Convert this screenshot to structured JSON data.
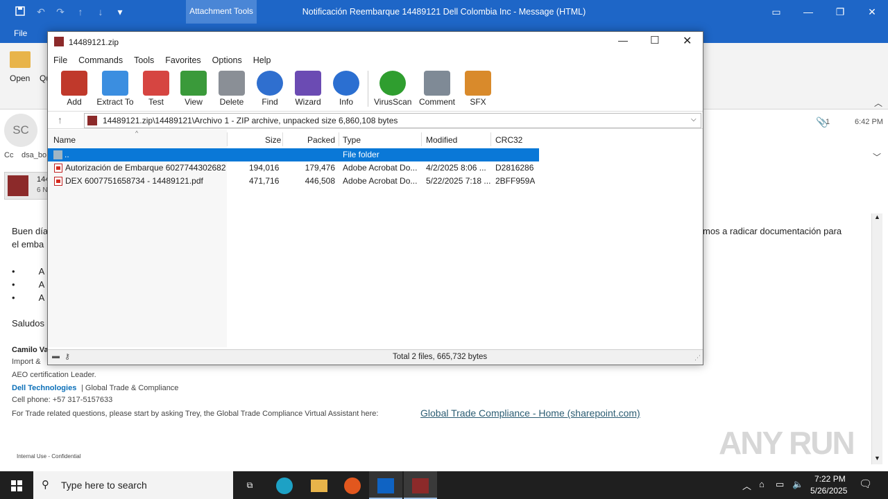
{
  "outlook": {
    "title": "Notificación Reembarque 14489121 Dell Colombia Inc  -  Message (HTML)",
    "context_tab": "Attachment Tools",
    "file_tab": "File",
    "ribbon": {
      "open_label": "Open",
      "quick_label": "Qu"
    },
    "header": {
      "avatar_initials": "SC",
      "cc_label": "Cc",
      "cc_value": "dsa_bo",
      "attachment_count": "1",
      "time": "6:42 PM",
      "attachment_name": "144",
      "attachment_size": "6 N"
    },
    "body": {
      "greeting": "Buen día",
      "greeting_tail": "mos a radicar documentación para",
      "line2": "el emba",
      "bullets": [
        "A",
        "A",
        "A"
      ],
      "closing": "Saludos",
      "signature_name": "Camilo Va",
      "signature_role": "Import &",
      "aeo": "AEO certification Leader.",
      "company": "Dell Technologies",
      "division": "| Global Trade & Compliance",
      "phone": "Cell phone: +57 317-5157633",
      "trade_text": "For Trade related questions, please start by asking Trey, the Global Trade Compliance Virtual Assistant here: ",
      "trade_link": "Global Trade Compliance - Home (sharepoint.com)",
      "classification": "Internal Use - Confidential"
    },
    "watermark": "ANY RUN"
  },
  "winrar": {
    "title": "14489121.zip",
    "menu": [
      "File",
      "Commands",
      "Tools",
      "Favorites",
      "Options",
      "Help"
    ],
    "toolbar": [
      {
        "label": "Add",
        "icon": "add-icon",
        "color": "#c0392b"
      },
      {
        "label": "Extract To",
        "icon": "extract-to-icon",
        "color": "#3b8ee0"
      },
      {
        "label": "Test",
        "icon": "test-icon",
        "color": "#d64541"
      },
      {
        "label": "View",
        "icon": "view-icon",
        "color": "#3a9a3a"
      },
      {
        "label": "Delete",
        "icon": "delete-icon",
        "color": "#8a8f96"
      },
      {
        "label": "Find",
        "icon": "find-icon",
        "color": "#2f6fcf"
      },
      {
        "label": "Wizard",
        "icon": "wizard-icon",
        "color": "#6b4bb3"
      },
      {
        "label": "Info",
        "icon": "info-icon",
        "color": "#2b6fd1"
      },
      {
        "label": "VirusScan",
        "icon": "virusscan-icon",
        "color": "#2f9e2f"
      },
      {
        "label": "Comment",
        "icon": "comment-icon",
        "color": "#7f8a96"
      },
      {
        "label": "SFX",
        "icon": "sfx-icon",
        "color": "#d98a2b"
      }
    ],
    "path": "14489121.zip\\14489121\\Archivo 1 - ZIP archive, unpacked size 6,860,108 bytes",
    "columns": [
      "Name",
      "Size",
      "Packed",
      "Type",
      "Modified",
      "CRC32"
    ],
    "rows": [
      {
        "name": "..",
        "size": "",
        "packed": "",
        "type": "File folder",
        "modified": "",
        "crc": ""
      },
      {
        "name": "Autorización de Embarque 6027744302682...",
        "size": "194,016",
        "packed": "179,476",
        "type": "Adobe Acrobat Do...",
        "modified": "4/2/2025 8:06 ...",
        "crc": "D2816286"
      },
      {
        "name": "DEX 6007751658734 - 14489121.pdf",
        "size": "471,716",
        "packed": "446,508",
        "type": "Adobe Acrobat Do...",
        "modified": "5/22/2025 7:18 ...",
        "crc": "2BFF959A"
      }
    ],
    "status": "Total 2 files, 665,732 bytes"
  },
  "taskbar": {
    "search_placeholder": "Type here to search",
    "time": "7:22 PM",
    "date": "5/26/2025"
  }
}
